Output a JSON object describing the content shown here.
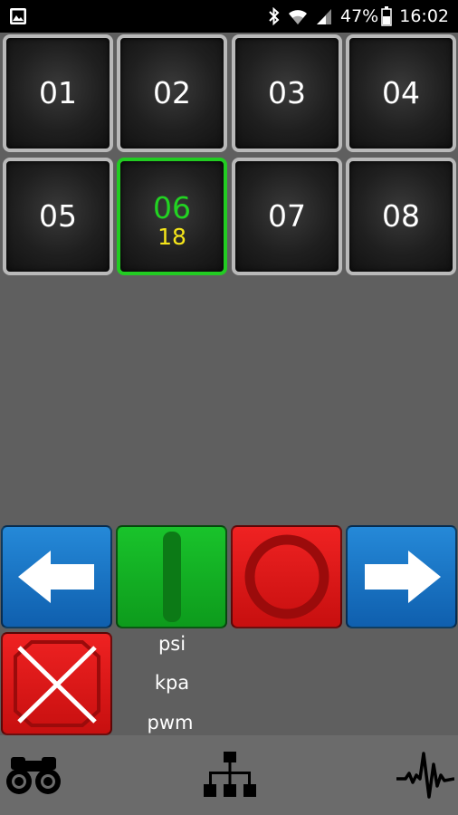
{
  "status_bar": {
    "battery_percent": "47%",
    "time": "16:02"
  },
  "tiles": [
    {
      "number": "01"
    },
    {
      "number": "02"
    },
    {
      "number": "03"
    },
    {
      "number": "04"
    },
    {
      "number": "05"
    },
    {
      "number": "06",
      "value": "18",
      "selected": true
    },
    {
      "number": "07"
    },
    {
      "number": "08"
    }
  ],
  "controls": {
    "left_icon": "arrow-left-icon",
    "start_icon": "vertical-bar-icon",
    "stop_icon": "circle-icon",
    "right_icon": "arrow-right-icon",
    "cancel_icon": "x-icon"
  },
  "units": [
    "psi",
    "kpa",
    "pwm"
  ],
  "nav": {
    "left_icon": "binoculars-icon",
    "center_icon": "network-icon",
    "right_icon": "pulse-icon"
  },
  "colors": {
    "selected": "#22cc22",
    "value": "#f5e51a",
    "blue": "#1f7ccf",
    "green": "#14b424",
    "red": "#e01818"
  }
}
